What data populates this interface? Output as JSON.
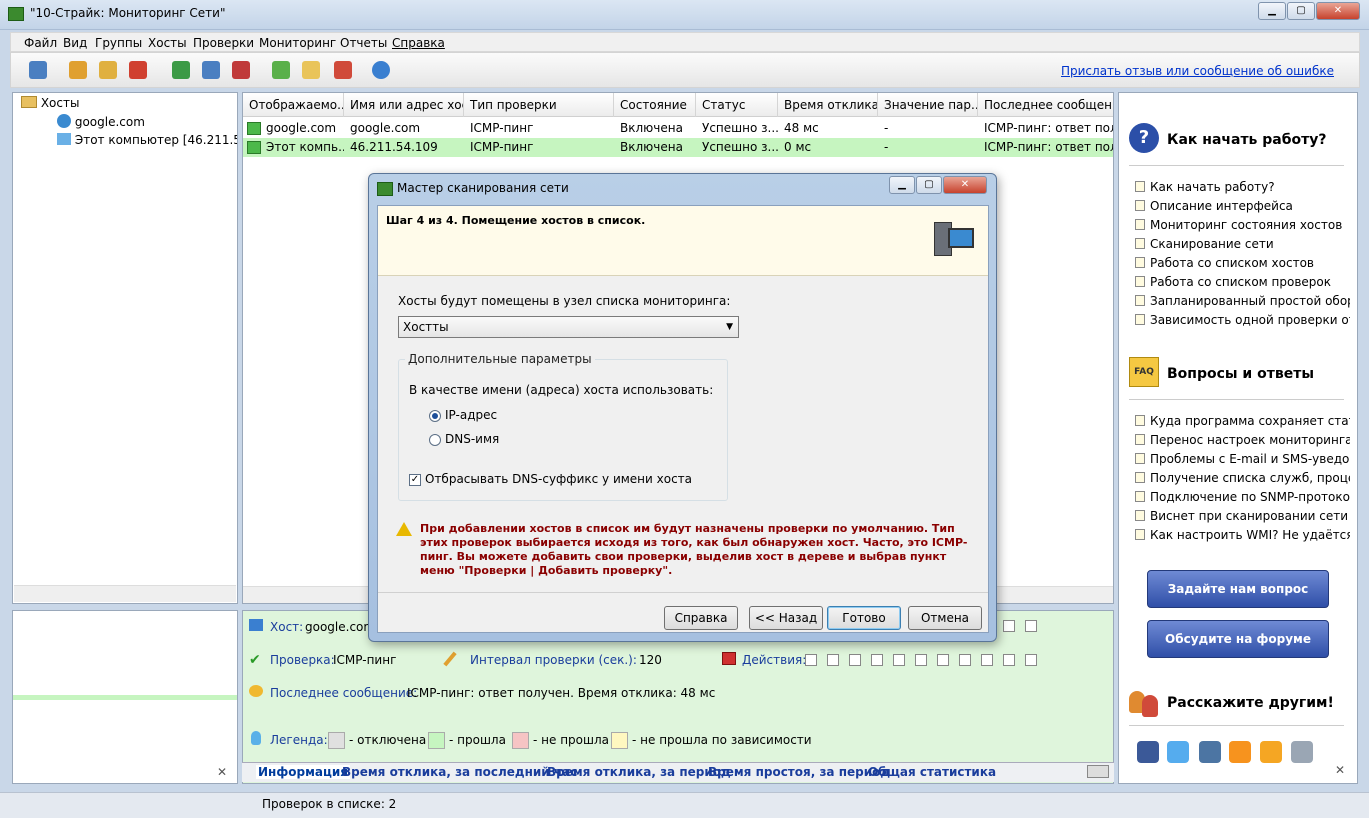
{
  "window": {
    "title": "\"10-Страйк: Мониторинг Сети\"",
    "minimize": "▁",
    "maximize": "▢",
    "close": "✕"
  },
  "menu": [
    "Файл",
    "Вид",
    "Группы",
    "Хосты",
    "Проверки",
    "Мониторинг",
    "Отчеты",
    "Справка"
  ],
  "toolbar": {
    "feedback_link": "Прислать отзыв или сообщение об ошибке",
    "icons": [
      "scan-network-icon",
      "add-host-icon",
      "find-host-icon",
      "delete-host-icon",
      "add-group-icon",
      "edit-group-icon",
      "delete-group-icon",
      "add-check-icon",
      "edit-check-icon",
      "delete-check-icon",
      "settings-icon"
    ]
  },
  "tree": {
    "root": "Хосты",
    "items": [
      "google.com",
      "Этот компьютер [46.211.54.109]"
    ]
  },
  "grid": {
    "columns": [
      "Отображаемо...",
      "Имя или адрес хост...",
      "Тип проверки",
      "Состояние",
      "Статус",
      "Время отклика",
      "Значение пар...",
      "Последнее сообщение"
    ],
    "rows": [
      [
        "google.com",
        "google.com",
        "ICMP-пинг",
        "Включена",
        "Успешно з...",
        "48 мс",
        "-",
        "ICMP-пинг: ответ полу..."
      ],
      [
        "Этот компь...",
        "46.211.54.109",
        "ICMP-пинг",
        "Включена",
        "Успешно з...",
        "0 мс",
        "-",
        "ICMP-пинг: ответ полу..."
      ]
    ],
    "row_colors": [
      "#ffffff",
      "#c6f5c0"
    ]
  },
  "help": {
    "getting_started_title": "Как начать работу?",
    "getting_started_links": [
      "Как начать работу?",
      "Описание интерфейса",
      "Мониторинг состояния хостов",
      "Сканирование сети",
      "Работа со списком хостов",
      "Работа со списком проверок",
      "Запланированный простой обор...",
      "Зависимость одной проверки от ..."
    ],
    "faq_badge": "FAQ",
    "faq_title": "Вопросы и ответы",
    "faq_links": [
      "Куда программа сохраняет стати...",
      "Перенос настроек мониторинга ...",
      "Проблемы с E-mail и SMS-уведо...",
      "Получение списка служб, проце...",
      "Подключение по SNMP-протоко...",
      "Виснет при сканировании сети с ...",
      "Как настроить WMI? Не удаётся н..."
    ],
    "ask_button": "Задайте нам вопрос",
    "forum_button": "Обсудите на форуме",
    "share_title": "Расскажите другим!"
  },
  "info": {
    "host_label": "Хост:",
    "host_value": "google.com",
    "check_label": "Проверка:",
    "check_value": "ICMP-пинг",
    "interval_label": "Интервал проверки (сек.):",
    "interval_value": "120",
    "actions_label": "Действия:",
    "last_msg_label": "Последнее сообщение:",
    "last_msg_value": "ICMP-пинг: ответ получен. Время отклика: 48 мс",
    "legend_label": "Легенда:",
    "legend": [
      {
        "text": "- отключена",
        "color": "#e0e0e0"
      },
      {
        "text": "- прошла",
        "color": "#c6f5c0"
      },
      {
        "text": "- не прошла",
        "color": "#f6c4c4"
      },
      {
        "text": "- не прошла по зависимости",
        "color": "#fff8c0"
      }
    ]
  },
  "tabs": [
    "Информация",
    "Время отклика, за последний час",
    "Время отклика, за период",
    "Время простоя, за период",
    "Общая статистика"
  ],
  "status": {
    "checks_count": "Проверок в списке: 2"
  },
  "dialog": {
    "title": "Мастер сканирования сети",
    "step": "Шаг 4 из 4. Помещение хостов в список.",
    "target_label": "Хосты будут помещены в узел списка мониторинга:",
    "target_value": "Хостты",
    "group_legend": "Дополнительные параметры",
    "name_label": "В качестве имени (адреса) хоста использовать:",
    "radio_ip": "IP-адрес",
    "radio_dns": "DNS-имя",
    "strip_dns": "Отбрасывать DNS-суффикс у имени хоста",
    "warning": "При добавлении хостов в список им будут назначены проверки по умолчанию. Тип этих проверок выбирается исходя из того, как был обнаружен хост. Часто, это ICMP-пинг. Вы можете добавить свои проверки, выделив хост в дереве и выбрав пункт меню \"Проверки | Добавить проверку\".",
    "help_btn": "Справка",
    "back_btn": "<< Назад",
    "finish_btn": "Готово",
    "cancel_btn": "Отмена"
  }
}
